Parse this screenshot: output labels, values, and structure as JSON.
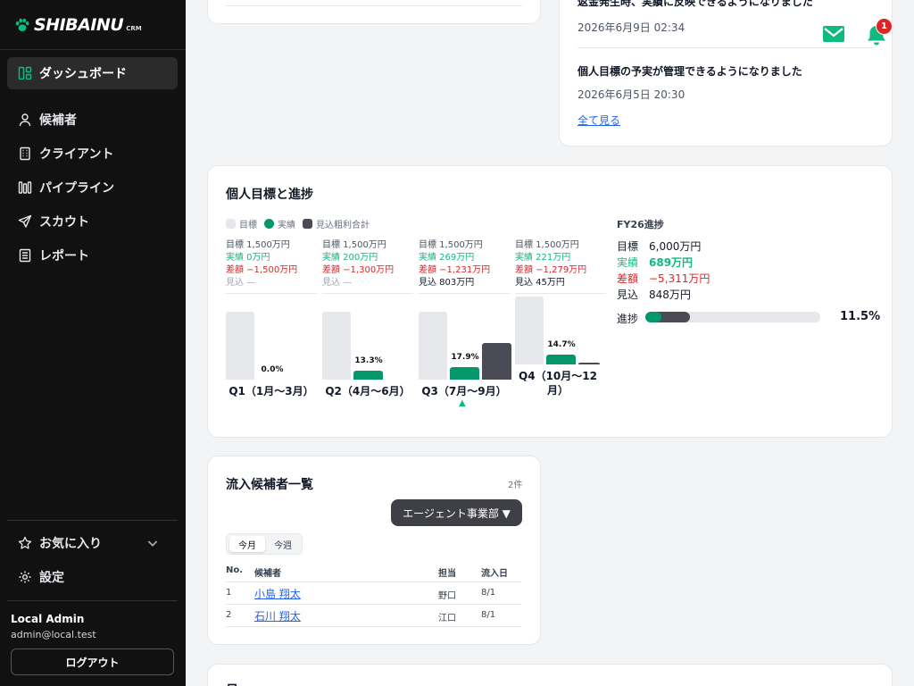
{
  "brand": {
    "name": "SHIBAINU",
    "suffix": "CRM"
  },
  "sidebar": {
    "active": {
      "label": "ダッシュボード",
      "icon": "dashboard-icon"
    },
    "items": [
      {
        "label": "候補者",
        "icon": "person-icon"
      },
      {
        "label": "クライアント",
        "icon": "building-icon"
      },
      {
        "label": "パイプライン",
        "icon": "pipeline-icon"
      },
      {
        "label": "スカウト",
        "icon": "send-icon"
      },
      {
        "label": "レポート",
        "icon": "report-icon"
      }
    ],
    "favorites": {
      "label": "お気に入り",
      "icon": "star-icon"
    },
    "settings": {
      "label": "設定",
      "icon": "gear-icon"
    },
    "user": {
      "name": "Local Admin",
      "email": "admin@local.test"
    },
    "logout_label": "ログアウト"
  },
  "header": {
    "notification_count": "1"
  },
  "notices": {
    "items": [
      {
        "title": "返金発生時、実績に反映できるようになりました",
        "date": "2026年6月9日 02:34"
      },
      {
        "title": "個人目標の予実が管理できるようになりました",
        "date": "2026年6月5日 20:30"
      }
    ],
    "see_all": "全て見る"
  },
  "goals": {
    "title": "個人目標と進捗",
    "legend": [
      "目標",
      "実績",
      "見込粗利合計"
    ],
    "colors": {
      "target": "#e5e7eb",
      "actual": "#059669",
      "forecast": "#4b4b55"
    },
    "quarters": [
      {
        "label": "Q1（1月〜3月）",
        "target": "目標 1,500万円",
        "actual": "実績 0万円",
        "diff": "差額 −1,500万円",
        "forecast": "見込 —",
        "pct": "0.0%",
        "target_value": 1500,
        "actual_value": 0,
        "forecast_value": 0
      },
      {
        "label": "Q2（4月〜6月）",
        "target": "目標 1,500万円",
        "actual": "実績 200万円",
        "diff": "差額 −1,300万円",
        "forecast": "見込 —",
        "pct": "13.3%",
        "target_value": 1500,
        "actual_value": 200,
        "forecast_value": 0
      },
      {
        "label": "Q3（7月〜9月）",
        "target": "目標 1,500万円",
        "actual": "実績 269万円",
        "diff": "差額 −1,231万円",
        "forecast": "見込 803万円",
        "pct": "17.9%",
        "current": true,
        "target_value": 1500,
        "actual_value": 269,
        "forecast_value": 803
      },
      {
        "label": "Q4（10月〜12月）",
        "target": "目標 1,500万円",
        "actual": "実績 221万円",
        "diff": "差額 −1,279万円",
        "forecast": "見込 45万円",
        "pct": "14.7%",
        "target_value": 1500,
        "actual_value": 221,
        "forecast_value": 45
      }
    ],
    "current_marker": "▲",
    "fy": {
      "title": "FY26進捗",
      "rows": [
        {
          "k": "目標",
          "v": "6,000万円"
        },
        {
          "k": "実績",
          "v": "689万円"
        },
        {
          "k": "差額",
          "v": "−5,311万円"
        },
        {
          "k": "見込",
          "v": "848万円"
        }
      ],
      "progress_label": "進捗",
      "progress_pct": "11.5%",
      "actual_fraction": 0.115,
      "forecast_fraction": 0.141
    }
  },
  "inflow": {
    "title": "流入候補者一覧",
    "count": "2件",
    "dept_filter": "エージェント事業部 ▼",
    "periods": [
      "今月",
      "今週"
    ],
    "columns": [
      "No.",
      "候補者",
      "担当",
      "流入日"
    ],
    "rows": [
      {
        "no": "1",
        "name": "小島 翔太",
        "owner": "野口",
        "date": "8/1"
      },
      {
        "no": "2",
        "name": "石川 翔太",
        "owner": "江口",
        "date": "8/1"
      }
    ]
  },
  "bottom_card": {
    "title": "日"
  }
}
